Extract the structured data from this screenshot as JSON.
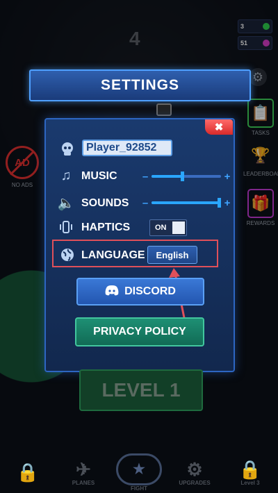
{
  "background": {
    "level_number": "4"
  },
  "currency": [
    {
      "value": "3",
      "icon": "dollar-icon",
      "color": "#2fcf4e"
    },
    {
      "value": "51",
      "icon": "gem-icon",
      "color": "#d63cc8"
    }
  ],
  "side_right": [
    {
      "label": "TASKS",
      "icon": "clipboard-icon",
      "color": "#3fd25a"
    },
    {
      "label": "LEADERBOARD",
      "icon": "trophy-icon",
      "color": "#e8c21c"
    },
    {
      "label": "REWARDS",
      "icon": "gift-icon",
      "color": "#c33bd6"
    }
  ],
  "side_left": {
    "noads_label": "NO ADS",
    "noads_badge": "AD"
  },
  "settings": {
    "title": "SETTINGS",
    "close_label": "✖",
    "player_name": "Player_92852",
    "music_label": "MUSIC",
    "music_level": 0.45,
    "sounds_label": "SOUNDS",
    "sounds_level": 0.98,
    "haptics_label": "HAPTICS",
    "haptics_state": "ON",
    "language_label": "LANGUAGE",
    "language_value": "English",
    "discord_label": "DISCORD",
    "privacy_label": "PRIVACY POLICY"
  },
  "level_button": "LEVEL 1",
  "bottom_nav": [
    {
      "label": "",
      "icon": "lock-icon"
    },
    {
      "label": "PLANES",
      "icon": "plane-icon"
    },
    {
      "label": "FIGHT",
      "icon": "fight-emblem-icon"
    },
    {
      "label": "UPGRADES",
      "icon": "upgrade-gear-icon"
    },
    {
      "label": "Level 3",
      "icon": "lock-icon"
    }
  ],
  "colors": {
    "accent_blue": "#2aa6ff",
    "panel_border": "#2d66c2",
    "highlight_red": "#e0505a",
    "privacy_green": "#1e8f74"
  }
}
